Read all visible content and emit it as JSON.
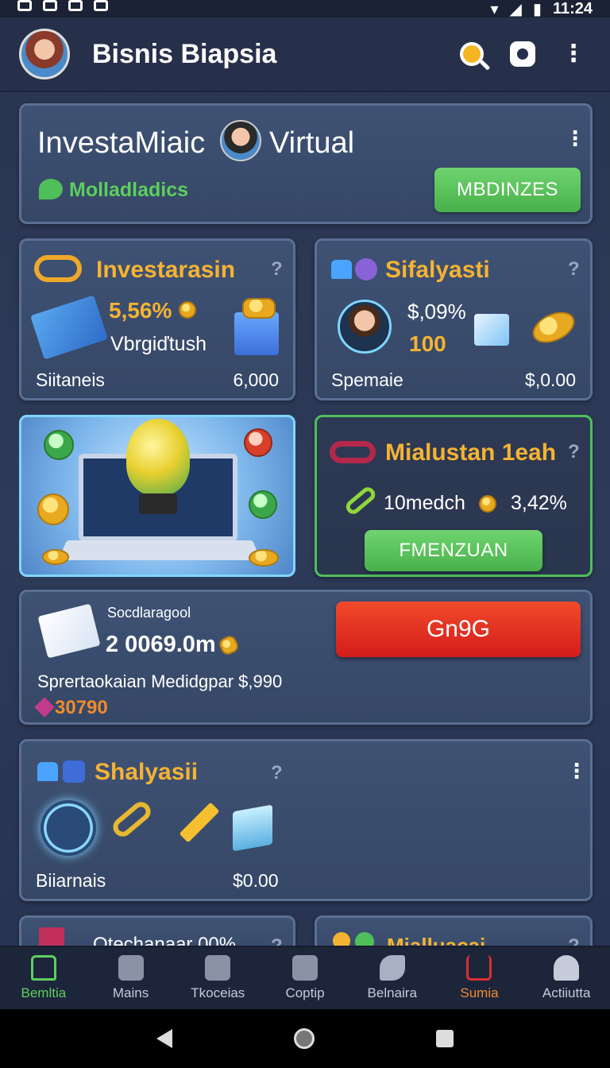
{
  "status_bar": {
    "time": "11:24"
  },
  "header": {
    "title": "Bisnis Biapsia"
  },
  "hero": {
    "title_left": "InvestaMiaic",
    "title_right": "Virtual",
    "subtitle": "Molladladics",
    "button": "MBDINZES"
  },
  "card_investarasin": {
    "title": "Investarasin",
    "percent": "5,56%",
    "subline": "Vbrgiďtush",
    "footer_label": "Siitaneis",
    "footer_value": "6,000"
  },
  "card_sifalyasti": {
    "title": "Sifalyasti",
    "percent": "$,09%",
    "value": "100",
    "footer_label": "Spemaie",
    "footer_value": "$,0.00"
  },
  "card_mialustan": {
    "title": "Mialustan 1eah",
    "label": "10medch",
    "percent": "3,42%",
    "button": "FMENZUAN"
  },
  "card_socdlaragool": {
    "small_label": "Socdlaragool",
    "amount": "2 0069.0m",
    "line": "Sprertaokaian Medidgpar $,990",
    "highlight": "30790",
    "button": "Gn9G"
  },
  "card_shalyasii": {
    "title": "Shalyasii",
    "footer_label": "Biiarnais",
    "footer_value": "$0.00"
  },
  "peek_cards": {
    "left_title": "Otechanaar 00%",
    "right_title": "Mialluacai"
  },
  "bottom_nav": [
    {
      "label": "Bemltia"
    },
    {
      "label": "Mains"
    },
    {
      "label": "Tkoceias"
    },
    {
      "label": "Coptip"
    },
    {
      "label": "Belnaira"
    },
    {
      "label": "Sumia"
    },
    {
      "label": "Actiiutta"
    }
  ],
  "colors": {
    "accent_gold": "#f5b332",
    "accent_green": "#5ccf5c",
    "accent_red": "#d41c1c",
    "accent_orange": "#f08a2a"
  }
}
